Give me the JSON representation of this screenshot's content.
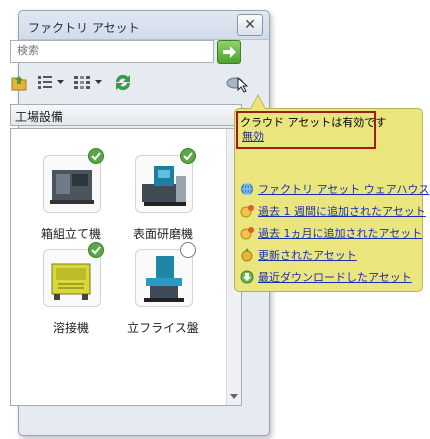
{
  "window": {
    "title": "ファクトリ アセット",
    "close_symbol": "✕"
  },
  "search": {
    "placeholder": "検索"
  },
  "toolbar": {
    "icons": [
      "folder-up-icon",
      "list-view-icon",
      "column-view-icon",
      "refresh-icon",
      "cloud-icon"
    ]
  },
  "category": {
    "selected": "工場設備"
  },
  "assets": [
    {
      "name": "箱組立て機",
      "status": "check"
    },
    {
      "name": "表面研磨機",
      "status": "check"
    },
    {
      "name": "溶接機",
      "status": "check"
    },
    {
      "name": "立フライス盤",
      "status": "empty"
    }
  ],
  "cloud_callout": {
    "status": "クラウド アセットは有効です",
    "disable_link": "無効",
    "links": [
      {
        "label": "ファクトリ アセット ウェアハウス",
        "icon": "globe-icon"
      },
      {
        "label": "過去 1 週間に追加されたアセット",
        "icon": "add-recent-icon"
      },
      {
        "label": "過去 1ヵ月に追加されたアセット",
        "icon": "add-recent-icon"
      },
      {
        "label": "更新されたアセット",
        "icon": "updated-icon"
      },
      {
        "label": "最近ダウンロードしたアセット",
        "icon": "download-icon"
      }
    ]
  },
  "colors": {
    "callout_bg": "#ebe57e",
    "status_border": "#a21c1c",
    "check_badge": "#58a845",
    "link": "#1a2fb5"
  }
}
